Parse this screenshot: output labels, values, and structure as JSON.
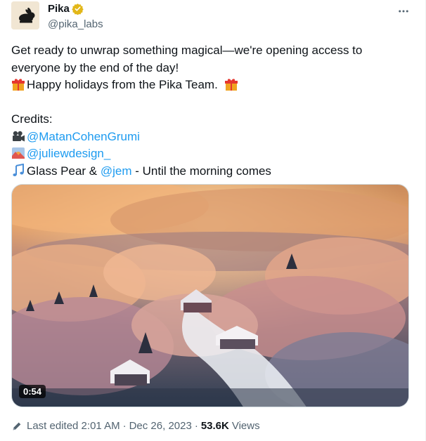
{
  "author": {
    "display_name": "Pika",
    "handle": "@pika_labs",
    "verified": true
  },
  "post": {
    "line1": "Get ready to unwrap something magical—we're opening access to",
    "line2": "everyone by the end of the day!",
    "line3": "Happy holidays from the Pika Team.",
    "credits_label": "Credits:",
    "credit_1": "@MatanCohenGrumi",
    "credit_2": "@juliewdesign_",
    "music_prefix": "Glass Pear & ",
    "music_mention": "@jem",
    "music_suffix": " - Until the morning comes"
  },
  "media": {
    "type": "video",
    "duration": "0:54"
  },
  "footer": {
    "edited": "Last edited 2:01 AM",
    "date": "Dec 26, 2023",
    "separator": "·",
    "views_count": "53.6K",
    "views_label": "Views"
  },
  "colors": {
    "link": "#1d9bf0",
    "secondary_text": "#536471",
    "verified_badge": "#e2b719"
  },
  "icons": [
    "rabbit-logo-icon",
    "verified-badge-icon",
    "more-options-icon",
    "gift-icon",
    "movie-camera-icon",
    "sunset-icon",
    "music-notes-icon",
    "pencil-icon"
  ]
}
